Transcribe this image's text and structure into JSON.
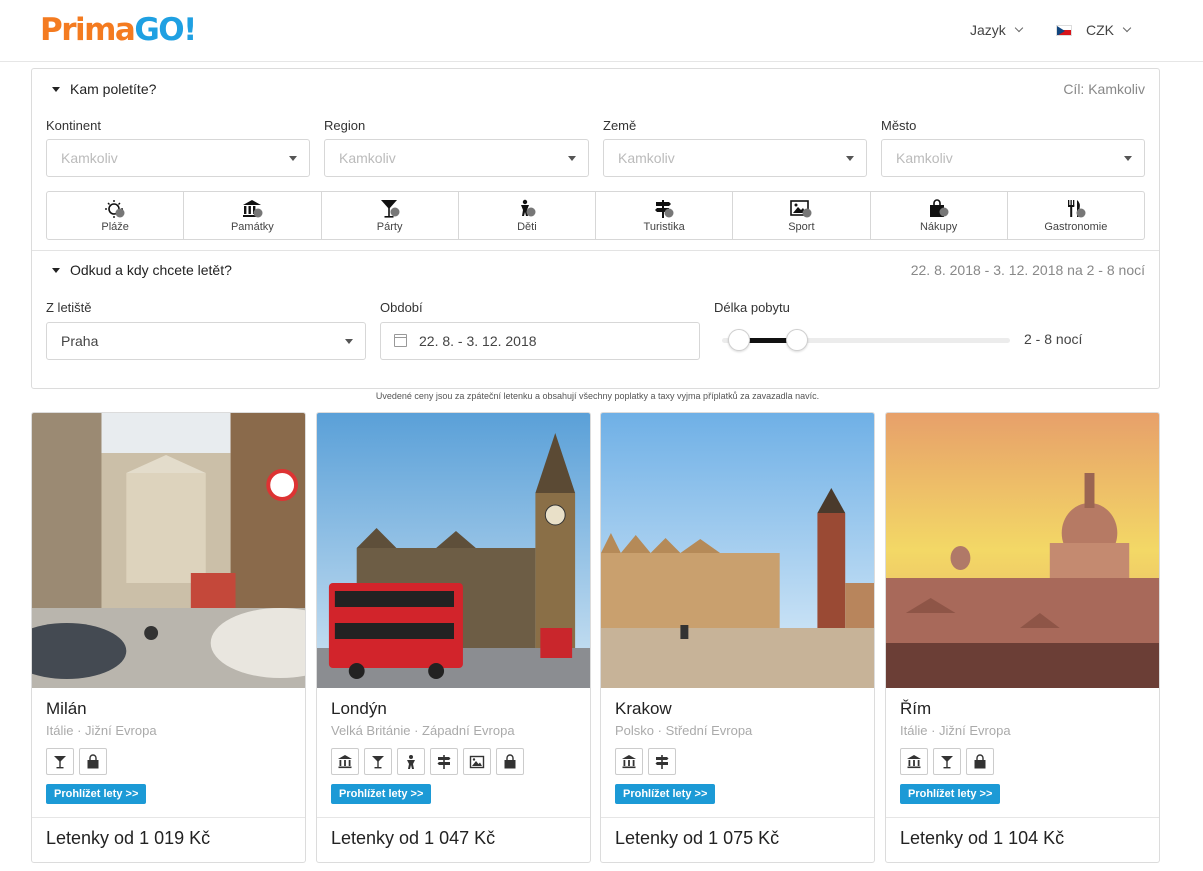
{
  "header": {
    "logo_part1": "Prima",
    "logo_part2": "GO!",
    "language_label": "Jazyk",
    "currency_label": "CZK"
  },
  "destination_section": {
    "title": "Kam poletíte?",
    "summary": "Cíl: Kamkoliv",
    "fields": [
      {
        "label": "Kontinent",
        "value": "Kamkoliv"
      },
      {
        "label": "Region",
        "value": "Kamkoliv"
      },
      {
        "label": "Země",
        "value": "Kamkoliv"
      },
      {
        "label": "Město",
        "value": "Kamkoliv"
      }
    ],
    "categories": [
      {
        "label": "Pláže",
        "icon": "beach-icon"
      },
      {
        "label": "Památky",
        "icon": "monument-icon"
      },
      {
        "label": "Párty",
        "icon": "cocktail-icon"
      },
      {
        "label": "Děti",
        "icon": "kids-icon"
      },
      {
        "label": "Turistika",
        "icon": "signpost-icon"
      },
      {
        "label": "Sport",
        "icon": "picture-icon"
      },
      {
        "label": "Nákupy",
        "icon": "shopping-bag-icon"
      },
      {
        "label": "Gastronomie",
        "icon": "cutlery-icon"
      }
    ]
  },
  "departure_section": {
    "title": "Odkud a kdy chcete letět?",
    "summary": "22. 8. 2018 - 3. 12. 2018 na 2 - 8 nocí",
    "airport_label": "Z letiště",
    "airport_value": "Praha",
    "period_label": "Období",
    "period_value": "22. 8. - 3. 12. 2018",
    "stay_label": "Délka pobytu",
    "stay_value": "2 - 8 nocí",
    "stay_range_fraction": [
      0.06,
      0.26
    ]
  },
  "note": "Uvedené ceny jsou za zpáteční letenku a obsahují všechny poplatky a taxy vyjma příplatků za zavazadla navíc.",
  "cards": [
    {
      "city": "Milán",
      "country": "Itálie · Jižní Evropa",
      "icons": [
        "cocktail-icon",
        "shopping-bag-icon"
      ],
      "button": "Prohlížet lety >>",
      "price": "Letenky od 1 019 Kč"
    },
    {
      "city": "Londýn",
      "country": "Velká Británie · Západní Evropa",
      "icons": [
        "monument-icon",
        "cocktail-icon",
        "kids-icon",
        "signpost-icon",
        "picture-icon",
        "shopping-bag-icon"
      ],
      "button": "Prohlížet lety >>",
      "price": "Letenky od 1 047 Kč"
    },
    {
      "city": "Krakow",
      "country": "Polsko · Střední Evropa",
      "icons": [
        "monument-icon",
        "signpost-icon"
      ],
      "button": "Prohlížet lety >>",
      "price": "Letenky od 1 075 Kč"
    },
    {
      "city": "Řím",
      "country": "Itálie · Jižní Evropa",
      "icons": [
        "monument-icon",
        "cocktail-icon",
        "shopping-bag-icon"
      ],
      "button": "Prohlížet lety >>",
      "price": "Letenky od 1 104 Kč"
    }
  ],
  "colors": {
    "brand_orange": "#f47b20",
    "brand_blue": "#1fa0e2",
    "button_blue": "#1c9ad6"
  }
}
